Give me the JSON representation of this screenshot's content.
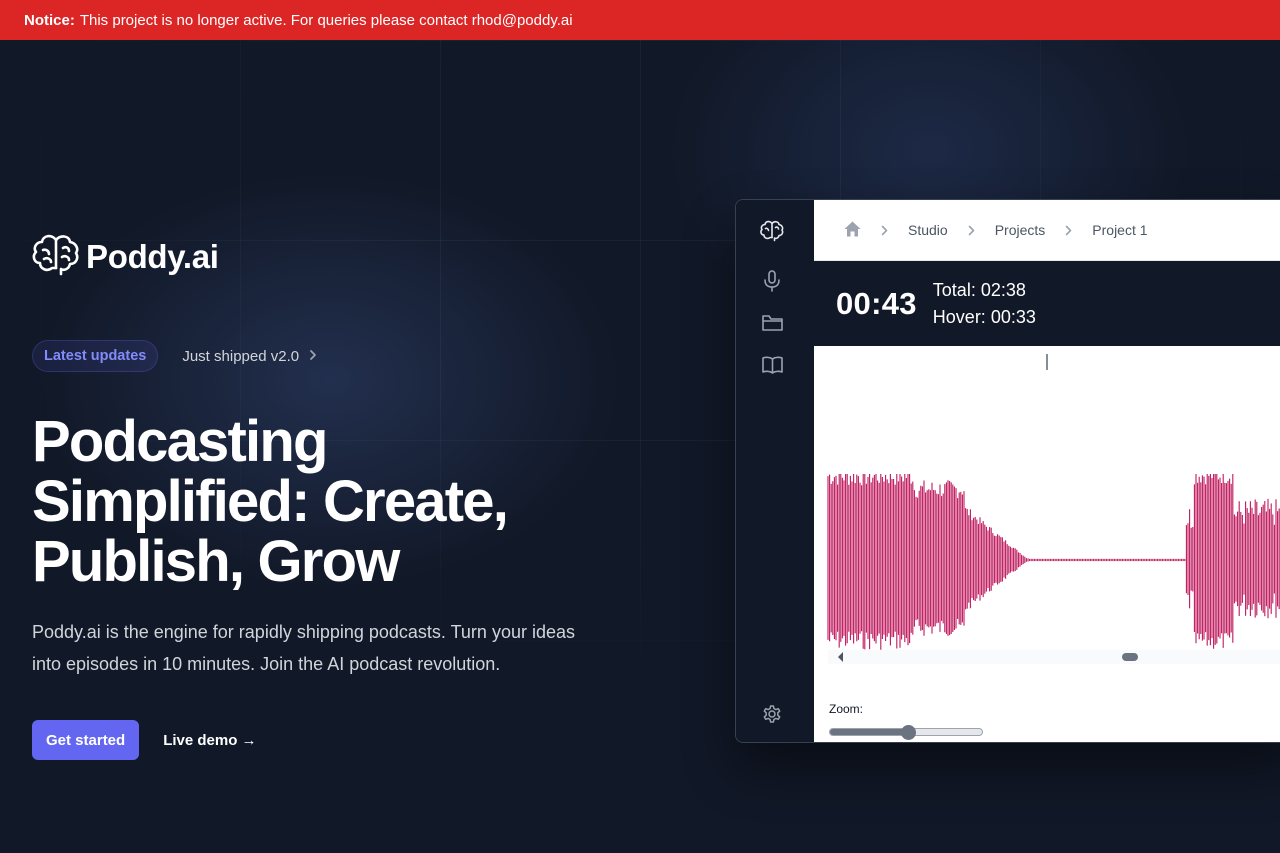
{
  "notice": {
    "label": "Notice:",
    "text": "This project is no longer active. For queries please contact rhod@poddy.ai"
  },
  "brand": {
    "name": "Poddy.ai",
    "icon": "brain-icon"
  },
  "hero": {
    "badge": "Latest updates",
    "shipped": "Just shipped v2.0",
    "headline": [
      "Podcasting",
      "Simplified: Create,",
      "Publish, Grow"
    ],
    "lead": [
      "Poddy.ai is the engine for rapidly shipping podcasts. Turn your ideas",
      "into episodes in 10 minutes. Join the AI podcast revolution."
    ],
    "primary_cta": "Get started",
    "secondary_cta": "Live demo →"
  },
  "app": {
    "sidebar_icons": [
      "brain-icon",
      "microphone-icon",
      "folder-icon",
      "book-icon",
      "gear-icon"
    ],
    "breadcrumbs": [
      "Studio",
      "Projects",
      "Project 1"
    ],
    "time": {
      "current": "00:43",
      "total": "Total: 02:38",
      "hover": "Hover: 00:33"
    },
    "waveform_color": "#be185d",
    "zoom_label": "Zoom:",
    "zoom_level": 0.51
  },
  "colors": {
    "notice": "#dc2626",
    "accent": "#6366f1",
    "background": "#111827"
  }
}
